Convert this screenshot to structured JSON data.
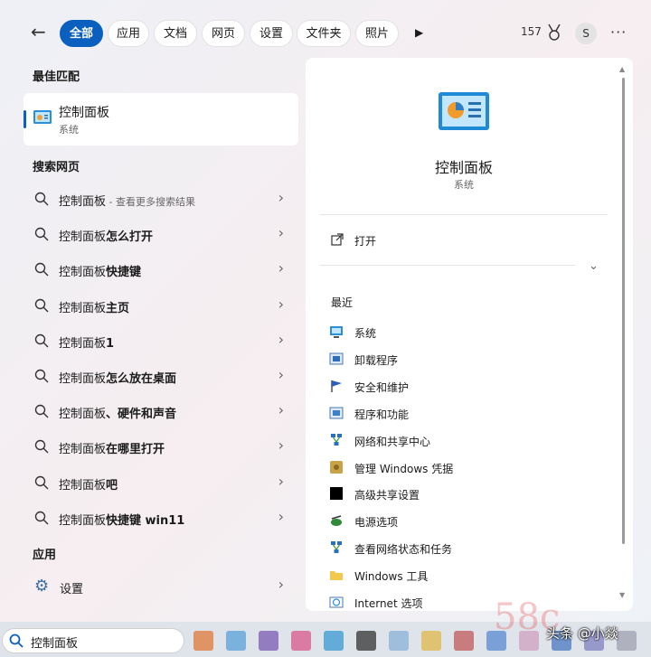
{
  "topbar": {
    "tabs": [
      {
        "label": "全部",
        "active": true
      },
      {
        "label": "应用"
      },
      {
        "label": "文档"
      },
      {
        "label": "网页"
      },
      {
        "label": "设置"
      },
      {
        "label": "文件夹"
      },
      {
        "label": "照片"
      }
    ],
    "points": "157",
    "avatar_initial": "S",
    "more_label": "···"
  },
  "best_match": {
    "section": "最佳匹配",
    "title": "控制面板",
    "subtitle": "系统"
  },
  "web_search": {
    "section": "搜索网页",
    "items": [
      {
        "base": "控制面板",
        "bold": "",
        "hint": " - 查看更多搜索结果"
      },
      {
        "base": "控制面板",
        "bold": "怎么打开",
        "hint": ""
      },
      {
        "base": "控制面板",
        "bold": "快捷键",
        "hint": ""
      },
      {
        "base": "控制面板",
        "bold": "主页",
        "hint": ""
      },
      {
        "base": "控制面板",
        "bold": "1",
        "hint": ""
      },
      {
        "base": "控制面板",
        "bold": "怎么放在桌面",
        "hint": ""
      },
      {
        "base": "控制面板",
        "bold": "、硬件和声音",
        "hint": ""
      },
      {
        "base": "控制面板",
        "bold": "在哪里打开",
        "hint": ""
      },
      {
        "base": "控制面板",
        "bold": "吧",
        "hint": ""
      },
      {
        "base": "控制面板",
        "bold": "快捷键 win11",
        "hint": ""
      }
    ]
  },
  "apps": {
    "section": "应用",
    "items": [
      {
        "label": "设置"
      }
    ]
  },
  "detail": {
    "title": "控制面板",
    "subtitle": "系统",
    "open_label": "打开",
    "recent_label": "最近",
    "recent_items": [
      {
        "label": "系统",
        "icon": "system-icon"
      },
      {
        "label": "卸载程序",
        "icon": "uninstall-icon"
      },
      {
        "label": "安全和维护",
        "icon": "flag-icon"
      },
      {
        "label": "程序和功能",
        "icon": "programs-icon"
      },
      {
        "label": "网络和共享中心",
        "icon": "network-icon"
      },
      {
        "label": "管理 Windows 凭据",
        "icon": "credential-icon"
      },
      {
        "label": "高级共享设置",
        "icon": "share-icon"
      },
      {
        "label": "电源选项",
        "icon": "power-icon"
      },
      {
        "label": "查看网络状态和任务",
        "icon": "network-icon"
      },
      {
        "label": "Windows 工具",
        "icon": "folder-icon"
      },
      {
        "label": "Internet 选项",
        "icon": "internet-icon"
      }
    ]
  },
  "taskbar": {
    "search_value": "控制面板"
  },
  "watermark": {
    "site": "58c",
    "author": "头条 @小燚"
  },
  "colors": {
    "accent": "#0a5fbf"
  }
}
